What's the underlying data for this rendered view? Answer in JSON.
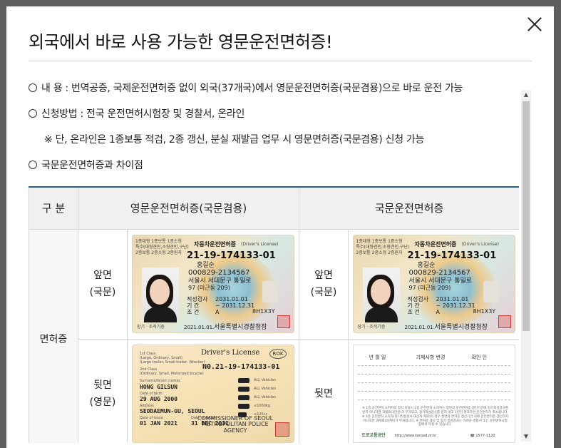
{
  "modal": {
    "title": "외국에서 바로 사용 가능한 영문운전면허증!",
    "close_label": "×"
  },
  "info": {
    "content_label": "내         용 : 번역공증, 국제운전면허증 없이 외국(37개국)에서 영문운전면허증(국문겸용)으로 바로 운전 가능",
    "apply_label": "신청방법 : 전국 운전면허시험장 및 경찰서, 온라인",
    "apply_note": "※ 단, 온라인은 1종보통 적검, 2종 갱신, 분실 재발급 업무 시 영문면허증(국문겸용) 신청 가능",
    "diff_label": "국문운전면허증과 차이점"
  },
  "table": {
    "headers": [
      "구 분",
      "영문운전면허증(국문겸용)",
      "국문운전면허증"
    ],
    "row_group": "면허증",
    "rows": [
      {
        "side_en_line1": "앞면",
        "side_en_line2": "(국문)",
        "side_kr_line1": "앞면",
        "side_kr_line2": "(국문)"
      },
      {
        "side_en_line1": "뒷면",
        "side_en_line2": "(영문)",
        "side_kr_line1": "뒷면",
        "side_kr_line2": ""
      }
    ]
  },
  "card_front": {
    "type_line1": "1종대형 1종보통 1종소형",
    "type_line2": "특수(대형견인,소형견인,구난)",
    "type_line3": "2종보통 2종소형 2종원자",
    "title": "자동차운전면허증",
    "title_en": "(Driver's License)",
    "number": "21-19-174133-01",
    "name": "홍길순",
    "id_number": "000829-2134567",
    "address1": "서울시 서대문구 통일로",
    "address2": "97 (미근동 209)",
    "renewal_label": "적성검사",
    "renewal_date": "2031.01.01",
    "period_label": "기    간",
    "period_date": "~ 2031.12.31",
    "condition_label": "조    건",
    "condition_value": "A",
    "serial": "8H1X3Y",
    "footer_left": "장기 · 조직기증",
    "footer_date": "2021.01.01.",
    "issuer": "서울특별시경찰청장"
  },
  "card_back_en": {
    "title": "Driver's License",
    "rok": "ROK",
    "number": "N0.21-19-174133-01",
    "class1": "1st Class",
    "class1_detail": "(Large, Ordinary, Small)",
    "class1_special": "(Large trailer, Small trailer, Wrecker)",
    "class2": "2nd Class",
    "class2_detail": "(Ordinary, Small, Motorized bicycle)",
    "name_label": "Surname/Given names",
    "name_value": "HONG GILSUN",
    "dob_label": "Date of birth",
    "dob_value": "29 AUG 2000",
    "addr_label": "Address",
    "addr_value": "SEODAEMUN-GU, SEOUL",
    "issue_label": "Date of issue",
    "issue_value": "01 JAN 2021",
    "expiry_label": "Date of expiry",
    "expiry_value": "31 DEC 2031",
    "vehicles": [
      "ALL Vehicles",
      "ALL Vehicles",
      "ALL Vehicles",
      "≤1000kg",
      "≤125cc"
    ],
    "commissioner": "COMMISSIONER OF SEOUL METROPOLITAN POLICE AGENCY"
  },
  "card_back_kr": {
    "col1": "년  월  일",
    "col2": "기재사항 변경",
    "col3": "확인 인",
    "notes": "※ 1종 운전면허 소지자의 정식 미실시 2종 운전면허 소지자는 정면의 운전면허증 갱신기간에 정기적성검사를 받지 아니하면 과태료(3만원)가 부과되고, 정기적성검사를 받지 않고 1년이 경과하면 운전면허가 취소됩니다. ※ 2종 운전면허 소지자(정기적성검사 대상자 제외)의 경우 정면의 면허증 갱신기간 내에 운전면허증 갱신하지 아니하면 과태료(2만원)가 부과됩니다. ※ 면허증 갱신 및 정기 적성검사는 가까운 경찰서 또는 운전면허시험장에서 하실 수 있습니다.",
    "logo": "도로교통공단",
    "url": "http://www.koroad.or.kr",
    "tel": "☎ 1577-1120"
  },
  "scrollbar": {
    "up_arrow": "▲",
    "down_arrow": "▼",
    "thumb_position": 0.0
  }
}
